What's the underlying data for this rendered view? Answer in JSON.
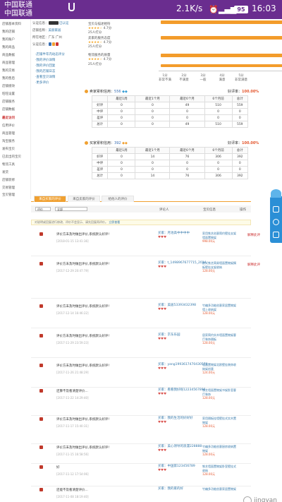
{
  "status_bar": {
    "carrier1": "中国联通",
    "carrier2": "中国联通",
    "speed": "2.1K/s",
    "battery": "95",
    "time": "16:03"
  },
  "sidebar": {
    "items": [
      "店铺基本资料",
      "我的店铺",
      "我的账户",
      "我的商品",
      "商品数据",
      "商品管理",
      "我的交易",
      "我的售后",
      "店铺绩效",
      "旺旺设置",
      "店铺服务",
      "店铺数据"
    ],
    "section": "最近访问",
    "recent": [
      "信用评价",
      "商品管理",
      "淘宝服务",
      "发布宝贝",
      "已卖出的宝贝",
      "物流工具",
      "发货",
      "店铺装修",
      "交易管理",
      "宝贝管理"
    ]
  },
  "account": {
    "auth_label": "认证信息",
    "auth_value": "已认证",
    "name_label": "店铺名称",
    "name_value": "美丽家居",
    "loc_label": "所在地区",
    "loc_value": "广东 广州",
    "vip_label": "认证信息"
  },
  "links": [
    "·店铺半年内动态评分",
    "·我的评价详情",
    "·我的评价回复",
    "·我的店铺日志",
    "·查看宝贝详情",
    "·更多评价"
  ],
  "ratings": [
    {
      "label": "宝贝与描述相符",
      "score": "4.7分",
      "count": "25人打分"
    },
    {
      "label": "卖家的服务态度",
      "score": "4.7分",
      "count": "25人打分"
    },
    {
      "label": "物流服务的质量",
      "score": "4.7分",
      "count": "25人打分"
    }
  ],
  "rating_axis": [
    "1分",
    "2分",
    "3分",
    "4分",
    "5分"
  ],
  "rating_axis_words": [
    "非常不满",
    "不满意",
    "一般",
    "满意",
    "非常满意"
  ],
  "seller_box": {
    "title": "卖家累积信用：",
    "credit": "556",
    "rate_label": "好评率：",
    "rate": "100.00%"
  },
  "seller_table": {
    "headers": [
      "",
      "最近1周",
      "最近1个月",
      "最近6个月",
      "6个月前",
      "总计"
    ],
    "rows": [
      [
        "好评",
        "0",
        "0",
        "49",
        "510",
        "559"
      ],
      [
        "中评",
        "0",
        "0",
        "0",
        "0",
        "0"
      ],
      [
        "差评",
        "0",
        "0",
        "0",
        "0",
        "0"
      ],
      [
        "总计",
        "0",
        "0",
        "49",
        "510",
        "559"
      ]
    ]
  },
  "buyer_box": {
    "title": "买家累积信用：",
    "credit": "392",
    "rate_label": "好评率：",
    "rate": "100.00%"
  },
  "buyer_table": {
    "headers": [
      "",
      "最近1周",
      "最近1个月",
      "最近6个月",
      "6个月前",
      "总计"
    ],
    "rows": [
      [
        "好评",
        "0",
        "14",
        "76",
        "306",
        "392"
      ],
      [
        "中评",
        "0",
        "0",
        "0",
        "0",
        "0"
      ],
      [
        "差评",
        "0",
        "0",
        "0",
        "0",
        "0"
      ],
      [
        "总计",
        "0",
        "14",
        "76",
        "306",
        "392"
      ]
    ]
  },
  "tabs": [
    "来自买家的评价",
    "来自卖家的评价",
    "给他人的评价"
  ],
  "filters": {
    "filter1": "评价",
    "filter2": "全部",
    "col_comment": "评论人",
    "col_item": "宝贝信息",
    "col_action": "操作"
  },
  "notice": {
    "text": "对说明或回复进行修改、评价不会显示、请先回复再评价。",
    "link": "立即查看"
  },
  "reviews": [
    {
      "text": "评价方未及时做出评价,系统默认好评!",
      "date": "[2018-01-15 13:41:36]",
      "buyer": "买家：月池高中中中中",
      "item": "家用铁艺创意简约壁挂支架墙面置物架",
      "price": "998.00元",
      "action": "解释此评"
    },
    {
      "text": "评价方未及时做出评价,系统默认好评!",
      "date": "[2017-12-29 20:47:79]",
      "buyer": "买家：t_1498967677715_2014",
      "item": "欧式铁艺简易墙面置物架搁板壁挂支架收纳",
      "price": "128.00元",
      "action": "解释此评"
    },
    {
      "text": "评价方未及时做出评价,系统默认好评!",
      "date": "[2017-12-14 16:46:22]",
      "buyer": "买家：美居53393432398",
      "item": "竹编多功能创意家居置物架墙上收纳架",
      "price": "128.00元",
      "action": ""
    },
    {
      "text": "评价方未及时做出评价,系统默认好评!",
      "date": "[2017-11-29 23:59:23]",
      "buyer": "买家：京东乐园",
      "item": "居家简约实木墙面置物架客厅装饰隔板",
      "price": "128.00元",
      "action": ""
    },
    {
      "text": "评价方未及时做出评价,系统默认好评!",
      "date": "[2017-11-26 21:48:29]",
      "buyer": "买家：yang1993617470430570",
      "item": "墙面置物架北欧壁挂装饰收纳架创意",
      "price": "124.00元",
      "action": ""
    },
    {
      "text": "还算不及看清楚评价...",
      "date": "[2017-11-22 14:29:40]",
      "buyer": "买家：看看我好呢12234567890",
      "item": "铁艺墙面置物架书架卧室客厅装饰",
      "price": "128.00元",
      "action": ""
    },
    {
      "text": "评价方未及时做出评价,系统默认好评!",
      "date": "[2017-11-17 15:40:31]",
      "buyer": "买家：我的生活的好好好",
      "item": "家用隔板挂墙壁挂式实木置物架",
      "price": "128.00元",
      "action": ""
    },
    {
      "text": "评价方未及时做出评价,系统默认好评!",
      "date": "[2017-11-15 16:58:56]",
      "buyer": "买家：美心领导的浪漫228888",
      "item": "竹编多功能创意厨房收纳置物架",
      "price": "128.00元",
      "action": ""
    },
    {
      "text": "好",
      "date": "[2017-11-12 17:54:06]",
      "buyer": "买家：中国第123456789",
      "item": "铁艺墙面置物架卧室壁挂式收纳",
      "price": "128.00元",
      "action": ""
    },
    {
      "text": "还能不及看清楚评价...",
      "date": "[2017-11-08 18:19:40]",
      "buyer": "买家：我的家的好",
      "item": "竹编多功能创意家居置物架",
      "price": "128.00元",
      "action": ""
    }
  ],
  "watermark": "jingyan"
}
